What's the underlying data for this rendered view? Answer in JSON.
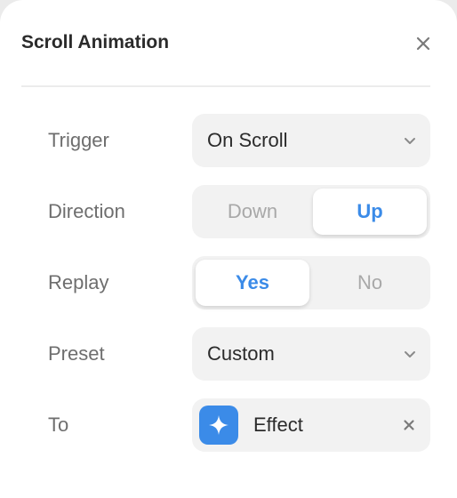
{
  "dialog": {
    "title": "Scroll Animation",
    "close_icon": "close-icon"
  },
  "fields": {
    "trigger": {
      "label": "Trigger",
      "value": "On Scroll",
      "icon": "chevron-down-icon"
    },
    "direction": {
      "label": "Direction",
      "options": [
        "Down",
        "Up"
      ],
      "selected": "Up"
    },
    "replay": {
      "label": "Replay",
      "options": [
        "Yes",
        "No"
      ],
      "selected": "Yes"
    },
    "preset": {
      "label": "Preset",
      "value": "Custom",
      "icon": "chevron-down-icon"
    },
    "to": {
      "label": "To",
      "value": "Effect",
      "icon": "sparkle-icon",
      "remove_icon": "close-icon"
    }
  },
  "colors": {
    "accent": "#3b8be8",
    "control_bg": "#f2f2f2",
    "label": "#6e6e6e",
    "text": "#2b2b2b",
    "inactive": "#a8a8a8"
  }
}
